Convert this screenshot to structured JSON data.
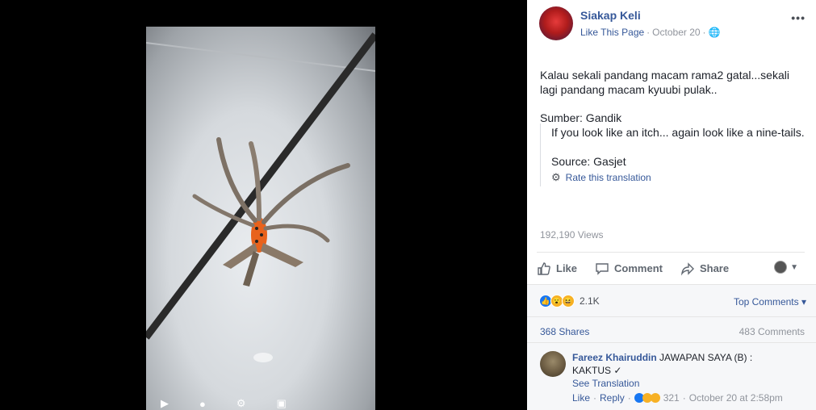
{
  "page": {
    "name": "Siakap Keli",
    "like_page": "Like This Page",
    "date": "October 20",
    "more": "•••"
  },
  "post": {
    "text_line1": "Kalau sekali pandang macam rama2 gatal...sekali lagi pandang macam kyuubi pulak..",
    "source": "Sumber: Gandik",
    "translation_line1": "If you look like an itch... again look like a nine-tails.",
    "translation_line2": "Source: Gasjet",
    "rate_translation": "Rate this translation",
    "views": "192,190 Views"
  },
  "actions": {
    "like": "Like",
    "comment": "Comment",
    "share": "Share"
  },
  "reactions": {
    "count": "2.1K",
    "types": [
      "like",
      "wow",
      "haha"
    ],
    "top_comments": "Top Comments ▾"
  },
  "counts": {
    "shares": "368 Shares",
    "comments": "483 Comments"
  },
  "comment": {
    "author": "Fareez Khairuddin",
    "text": "JAWAPAN SAYA (B) :",
    "text2": "KAKTUS ✓",
    "see_translation": "See Translation",
    "like": "Like",
    "reply": "Reply",
    "reaction_count": "321",
    "time": "October 20 at 2:58pm"
  },
  "colors": {
    "link": "#365899",
    "muted": "#90949c",
    "panel_bg": "#ffffff",
    "footer_bg": "#f6f7f9"
  }
}
